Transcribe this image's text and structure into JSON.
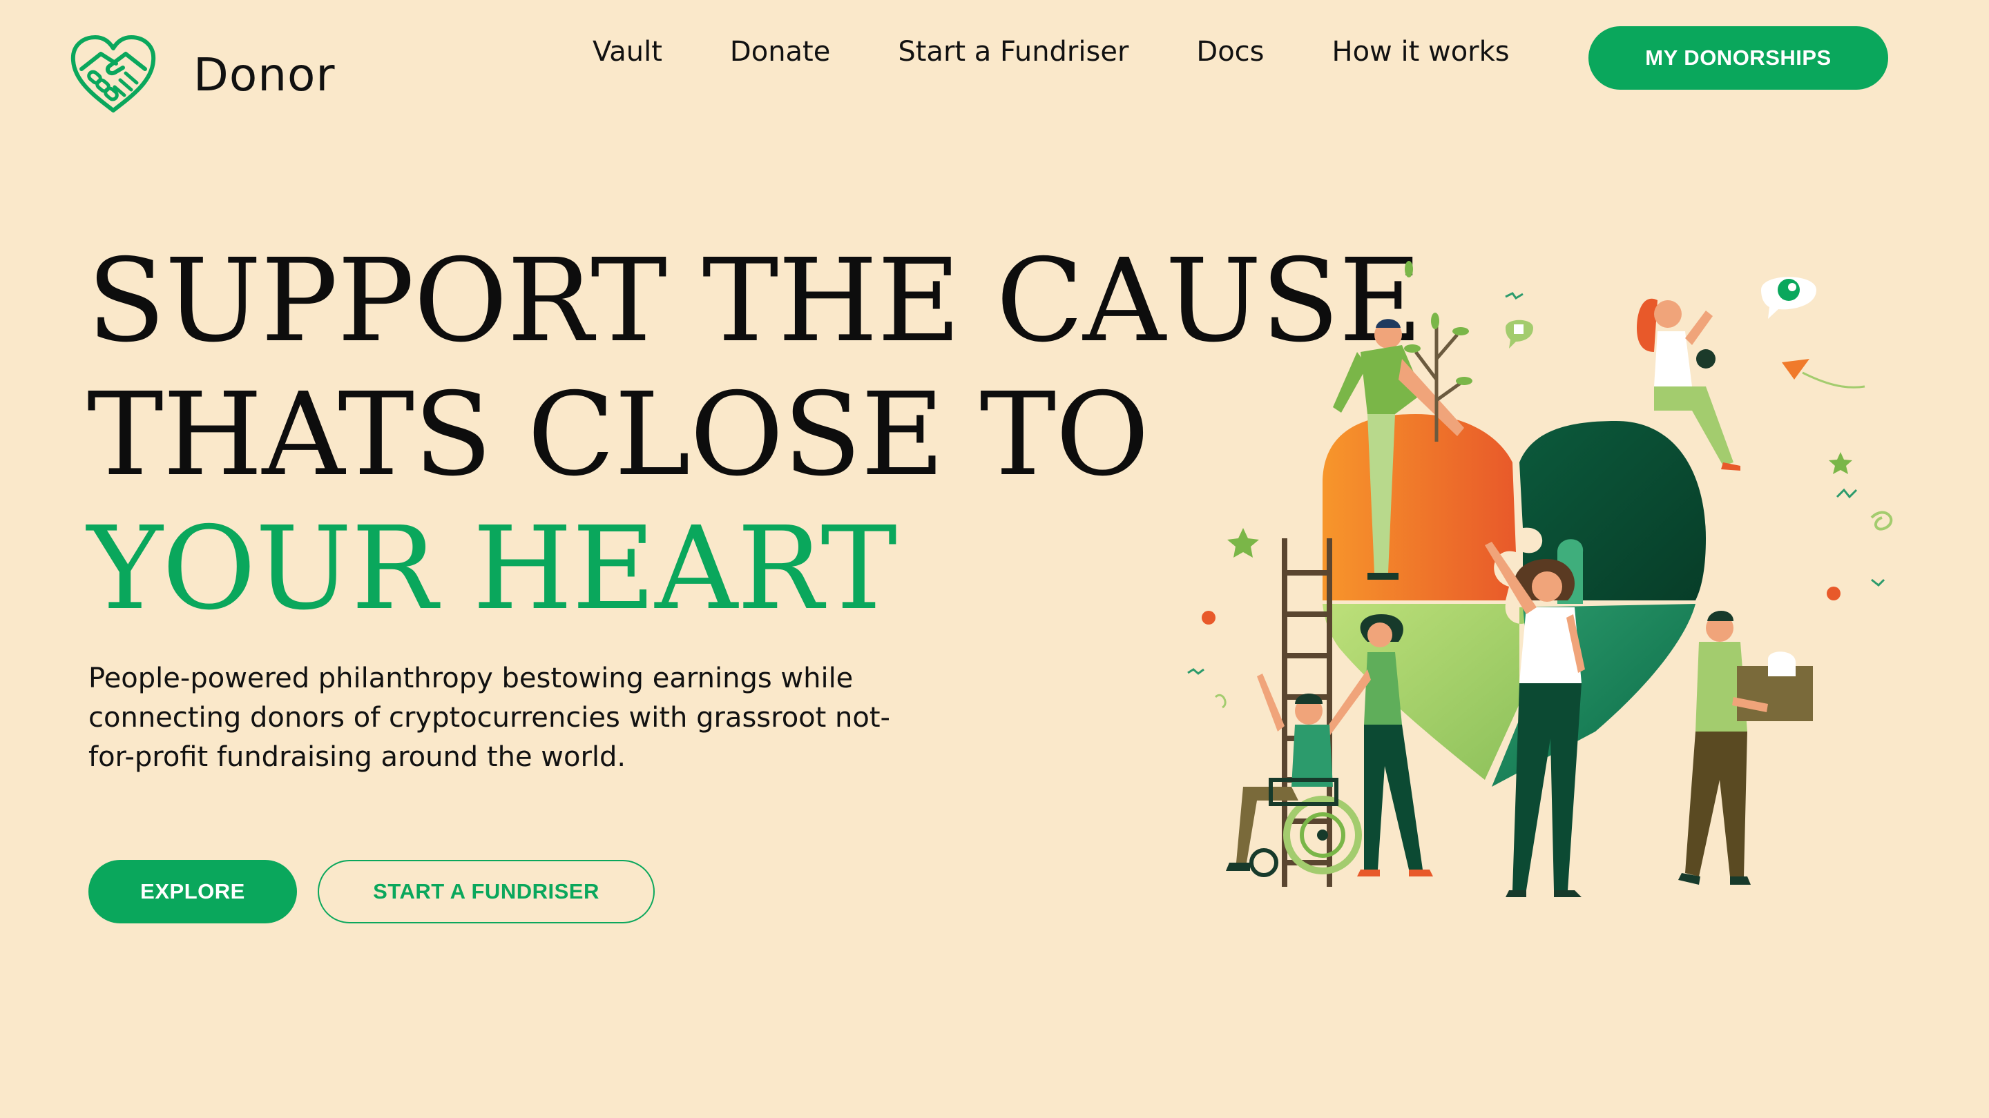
{
  "brand": {
    "name": "Donor",
    "logo_icon": "handshake-heart-icon"
  },
  "nav": {
    "items": [
      "Vault",
      "Donate",
      "Start a Fundriser",
      "Docs",
      "How it works"
    ],
    "cta_label": "MY DONORSHIPS"
  },
  "hero": {
    "title_line_1": "SUPPORT THE CAUSE",
    "title_line_2": "THATS CLOSE TO",
    "title_line_3": "YOUR HEART",
    "subtitle": "People-powered philanthropy bestowing earnings while connecting donors of cryptocurrencies with grassroot not-for-profit fundraising around the world.",
    "explore_label": "EXPLORE",
    "start_label": "START A FUNDRISER"
  },
  "colors": {
    "background": "#fae8ca",
    "accent": "#0aa75c",
    "text": "#111111"
  }
}
